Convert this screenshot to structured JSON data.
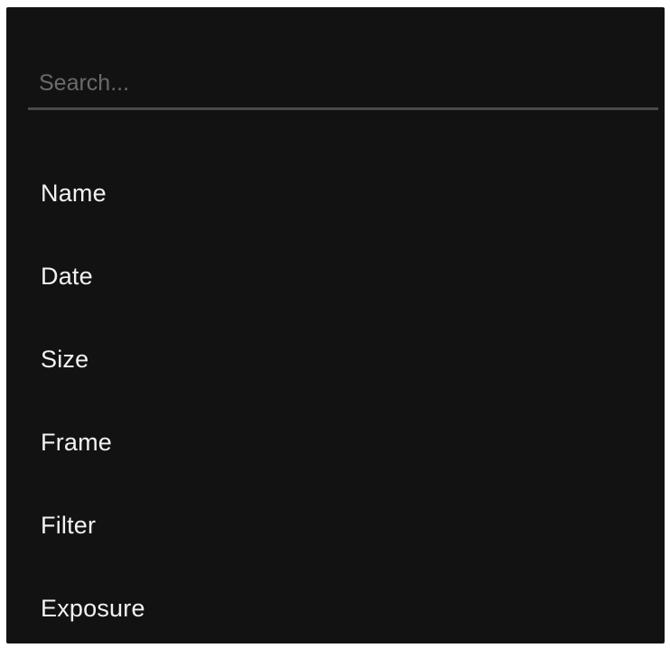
{
  "search": {
    "placeholder": "Search...",
    "value": ""
  },
  "menu": {
    "items": [
      {
        "label": "Name"
      },
      {
        "label": "Date"
      },
      {
        "label": "Size"
      },
      {
        "label": "Frame"
      },
      {
        "label": "Filter"
      },
      {
        "label": "Exposure"
      }
    ]
  },
  "colors": {
    "panel_background": "#121212",
    "divider": "#4a4a4a",
    "item_text": "#f2f2f2",
    "placeholder_text": "#6a6a6a"
  }
}
